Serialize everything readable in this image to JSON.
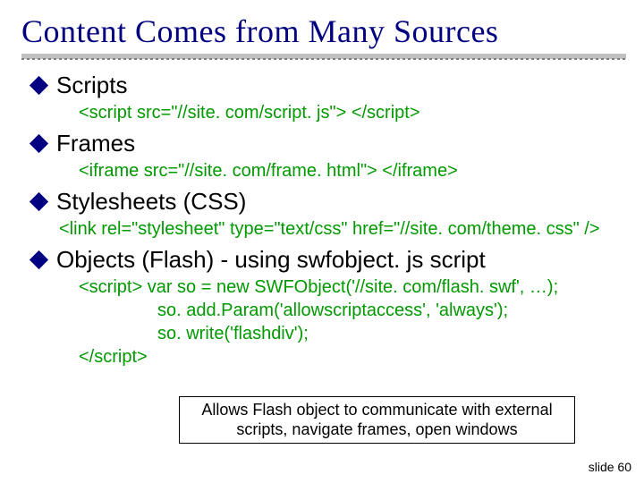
{
  "title": "Content Comes from Many Sources",
  "sections": {
    "scripts": {
      "label": "Scripts",
      "code": "<script  src=\"//site. com/script. js\">  </script>"
    },
    "frames": {
      "label": "Frames",
      "code": "<iframe  src=\"//site. com/frame. html\">  </iframe>"
    },
    "stylesheets": {
      "label": "Stylesheets (CSS)",
      "code": "<link rel=\"stylesheet\"  type=\"text/css\"  href=\"//site. com/theme. css\" />"
    },
    "objects": {
      "label": "Objects (Flash)  - using swfobject. js script",
      "code_open": "<script>",
      "code_l1": "var so = new SWFObject('//site. com/flash. swf', …);",
      "code_l2": "so. add.Param('allowscriptaccess',  'always');",
      "code_l3": "so. write('flashdiv');",
      "code_close": "</script>"
    }
  },
  "callout": "Allows Flash object to communicate with external scripts, navigate frames, open windows",
  "footer": "slide 60"
}
